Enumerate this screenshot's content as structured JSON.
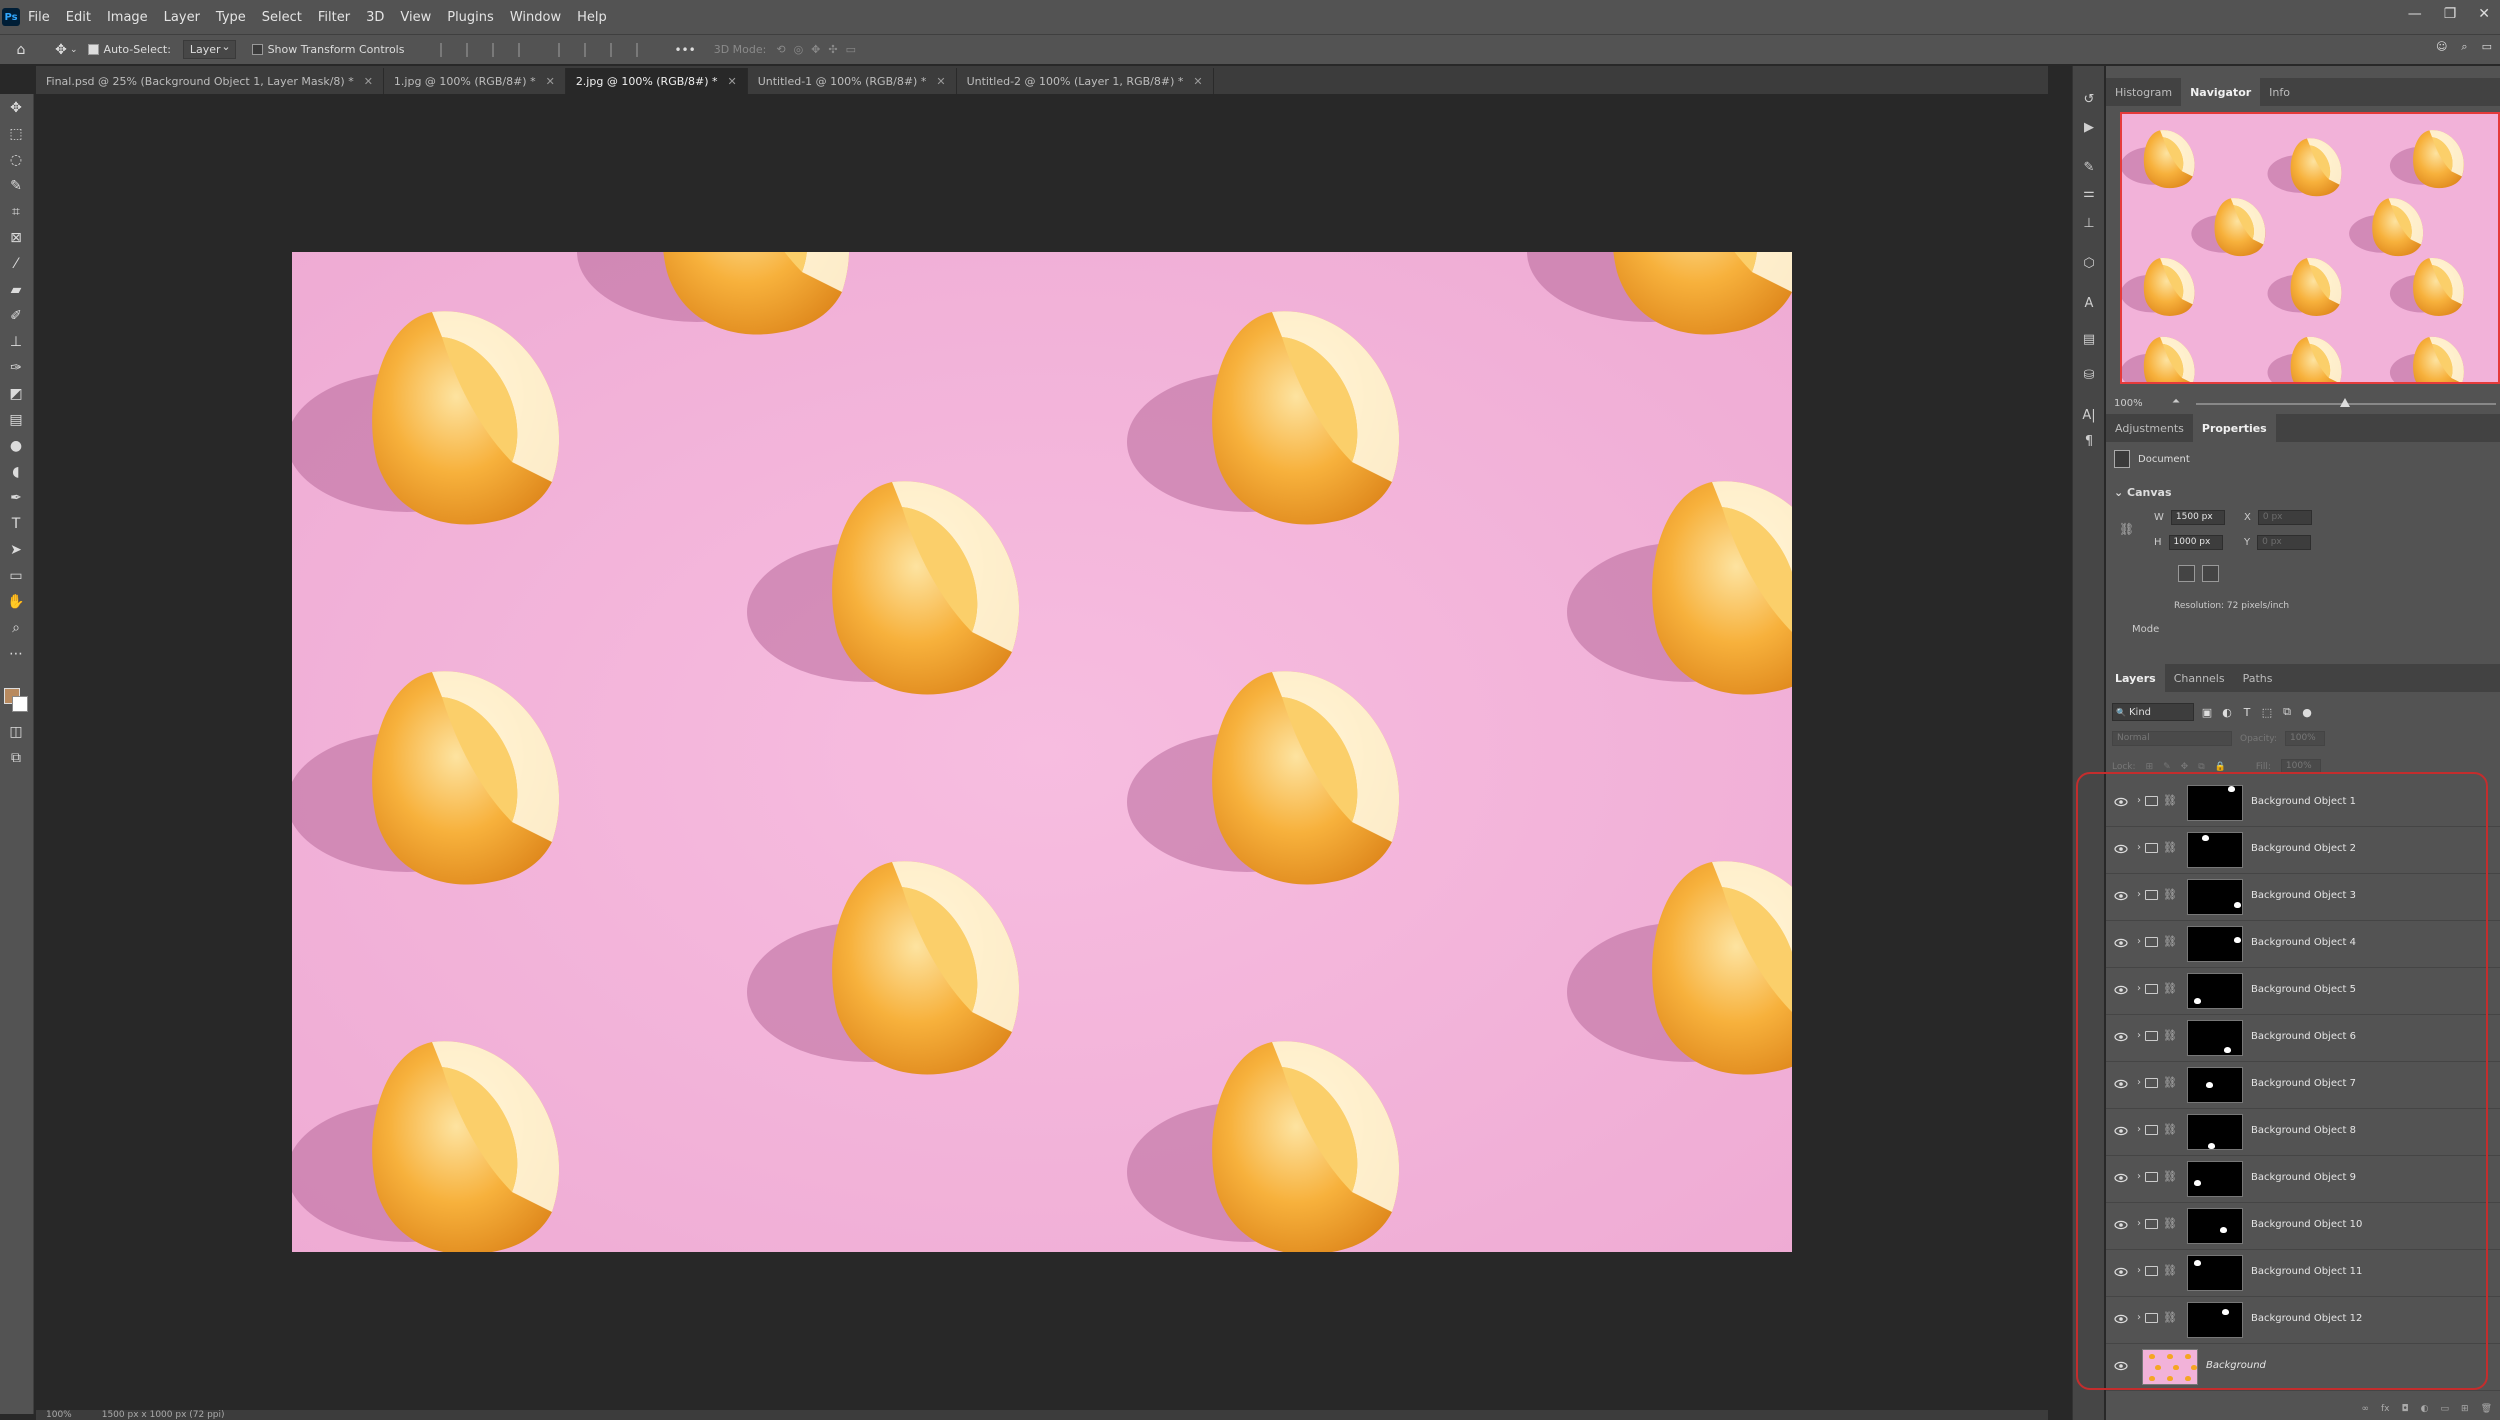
{
  "menu": [
    "File",
    "Edit",
    "Image",
    "Layer",
    "Type",
    "Select",
    "Filter",
    "3D",
    "View",
    "Plugins",
    "Window",
    "Help"
  ],
  "logo": "Ps",
  "options": {
    "auto_select_label": "Auto-Select:",
    "auto_select_target": "Layer",
    "show_transform_label": "Show Transform Controls",
    "mode_3d_label": "3D Mode:",
    "more_label": "•••"
  },
  "tabs": [
    {
      "label": "Final.psd @ 25% (Background Object 1, Layer Mask/8) *",
      "active": false
    },
    {
      "label": "1.jpg @ 100% (RGB/8#) *",
      "active": false
    },
    {
      "label": "2.jpg @ 100% (RGB/8#) *",
      "active": true
    },
    {
      "label": "Untitled-1 @ 100% (RGB/8#) *",
      "active": false
    },
    {
      "label": "Untitled-2 @ 100% (Layer 1, RGB/8#) *",
      "active": false
    }
  ],
  "status": {
    "zoom": "100%",
    "size": "1500 px x 1000 px (72 ppi)"
  },
  "panels": {
    "top_tabs": [
      "Histogram",
      "Navigator",
      "Info"
    ],
    "navigator_zoom": "100%",
    "mid_tabs": [
      "Adjustments",
      "Properties"
    ],
    "properties": {
      "document_label": "Document",
      "canvas_heading": "Canvas",
      "w_label": "W",
      "w_value": "1500 px",
      "h_label": "H",
      "h_value": "1000 px",
      "x_label": "X",
      "x_value": "0 px",
      "y_label": "Y",
      "y_value": "0 px",
      "resolution": "Resolution: 72 pixels/inch",
      "mode_label": "Mode"
    },
    "layer_tabs": [
      "Layers",
      "Channels",
      "Paths"
    ],
    "kind_filter": "Kind",
    "blend_mode": "Normal",
    "opacity_label": "Opacity:",
    "opacity_value": "100%",
    "lock_label": "Lock:",
    "fill_label": "Fill:",
    "fill_value": "100%"
  },
  "layers": [
    {
      "name": "Background Object 1"
    },
    {
      "name": "Background Object 2"
    },
    {
      "name": "Background Object 3"
    },
    {
      "name": "Background Object 4"
    },
    {
      "name": "Background Object 5"
    },
    {
      "name": "Background Object 6"
    },
    {
      "name": "Background Object 7"
    },
    {
      "name": "Background Object 8"
    },
    {
      "name": "Background Object 9"
    },
    {
      "name": "Background Object 10"
    },
    {
      "name": "Background Object 11"
    },
    {
      "name": "Background Object 12"
    },
    {
      "name": "Background"
    }
  ],
  "colors": {
    "canvas_pink": "#f2b2d9",
    "lemon": "#f5a623",
    "highlight": "#c42d2d",
    "foreground": "#b88a5f",
    "background": "#ffffff"
  }
}
